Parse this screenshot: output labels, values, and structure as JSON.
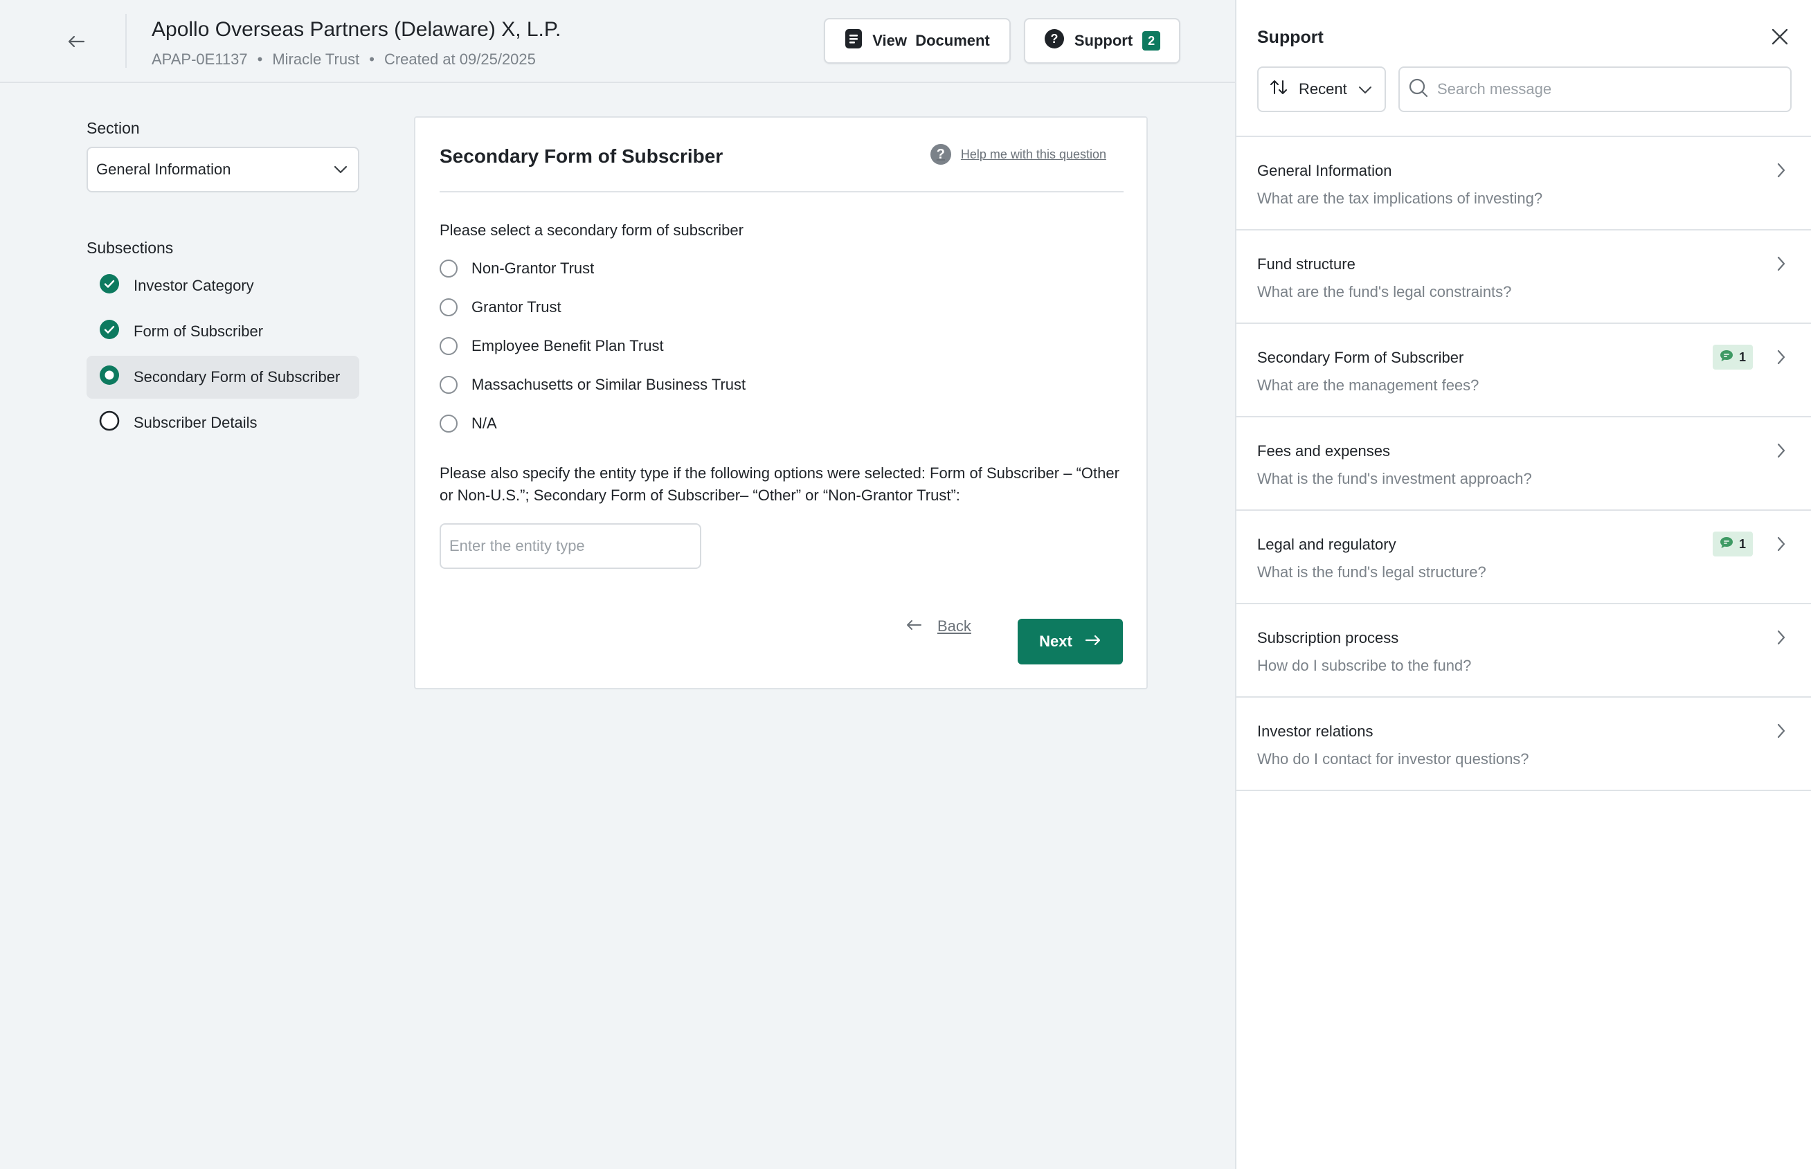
{
  "header": {
    "title": "Apollo Overseas Partners (Delaware) X, L.P.",
    "meta": {
      "code": "APAP-0E1137",
      "dot": "•",
      "trust": "Miracle Trust",
      "created": "Created at 09/25/2025"
    },
    "view_document_label": "View  Document",
    "support_label": "Support",
    "support_count": "2"
  },
  "left_nav": {
    "section_label": "Section",
    "section_value": "General Information",
    "subsections_label": "Subsections",
    "items": [
      {
        "label": "Investor Category",
        "state": "complete"
      },
      {
        "label": "Form of Subscriber",
        "state": "complete"
      },
      {
        "label": "Secondary Form of Subscriber",
        "state": "current"
      },
      {
        "label": "Subscriber Details",
        "state": "incomplete"
      }
    ]
  },
  "card": {
    "title": "Secondary Form of Subscriber",
    "help_label": "Help me with this question",
    "question": "Please select a secondary form of subscriber",
    "options": [
      "Non-Grantor Trust",
      "Grantor Trust",
      "Employee Benefit Plan Trust",
      "Massachusetts or Similar Business Trust",
      "N/A"
    ],
    "entity_question": "Please also specify the entity type if the following options were selected: Form of Subscriber – “Other or Non-U.S.”; Secondary Form of Subscriber– “Other” or “Non-Grantor Trust”:",
    "entity_placeholder": "Enter the entity type",
    "back_label": "Back",
    "next_label": "Next"
  },
  "support_panel": {
    "title": "Support",
    "sort_label": "Recent",
    "search_placeholder": "Search message",
    "topics": [
      {
        "title": "General Information",
        "question": "What are the tax implications of investing?",
        "count": ""
      },
      {
        "title": "Fund structure",
        "question": "What are the fund's legal constraints?",
        "count": ""
      },
      {
        "title": "Secondary Form of Subscriber",
        "question": "What are the management fees?",
        "count": "1"
      },
      {
        "title": "Fees and expenses",
        "question": "What is the fund's investment approach?",
        "count": ""
      },
      {
        "title": "Legal and regulatory",
        "question": "What is the fund's legal structure?",
        "count": "1"
      },
      {
        "title": "Subscription process",
        "question": "How do I subscribe to the fund?",
        "count": ""
      },
      {
        "title": "Investor relations",
        "question": "Who do I contact for investor questions?",
        "count": ""
      }
    ]
  },
  "colors": {
    "accent": "#0d7a5f",
    "badge_bg": "#dcefe3",
    "muted_text": "#7b8289",
    "border": "#d8dce0"
  }
}
